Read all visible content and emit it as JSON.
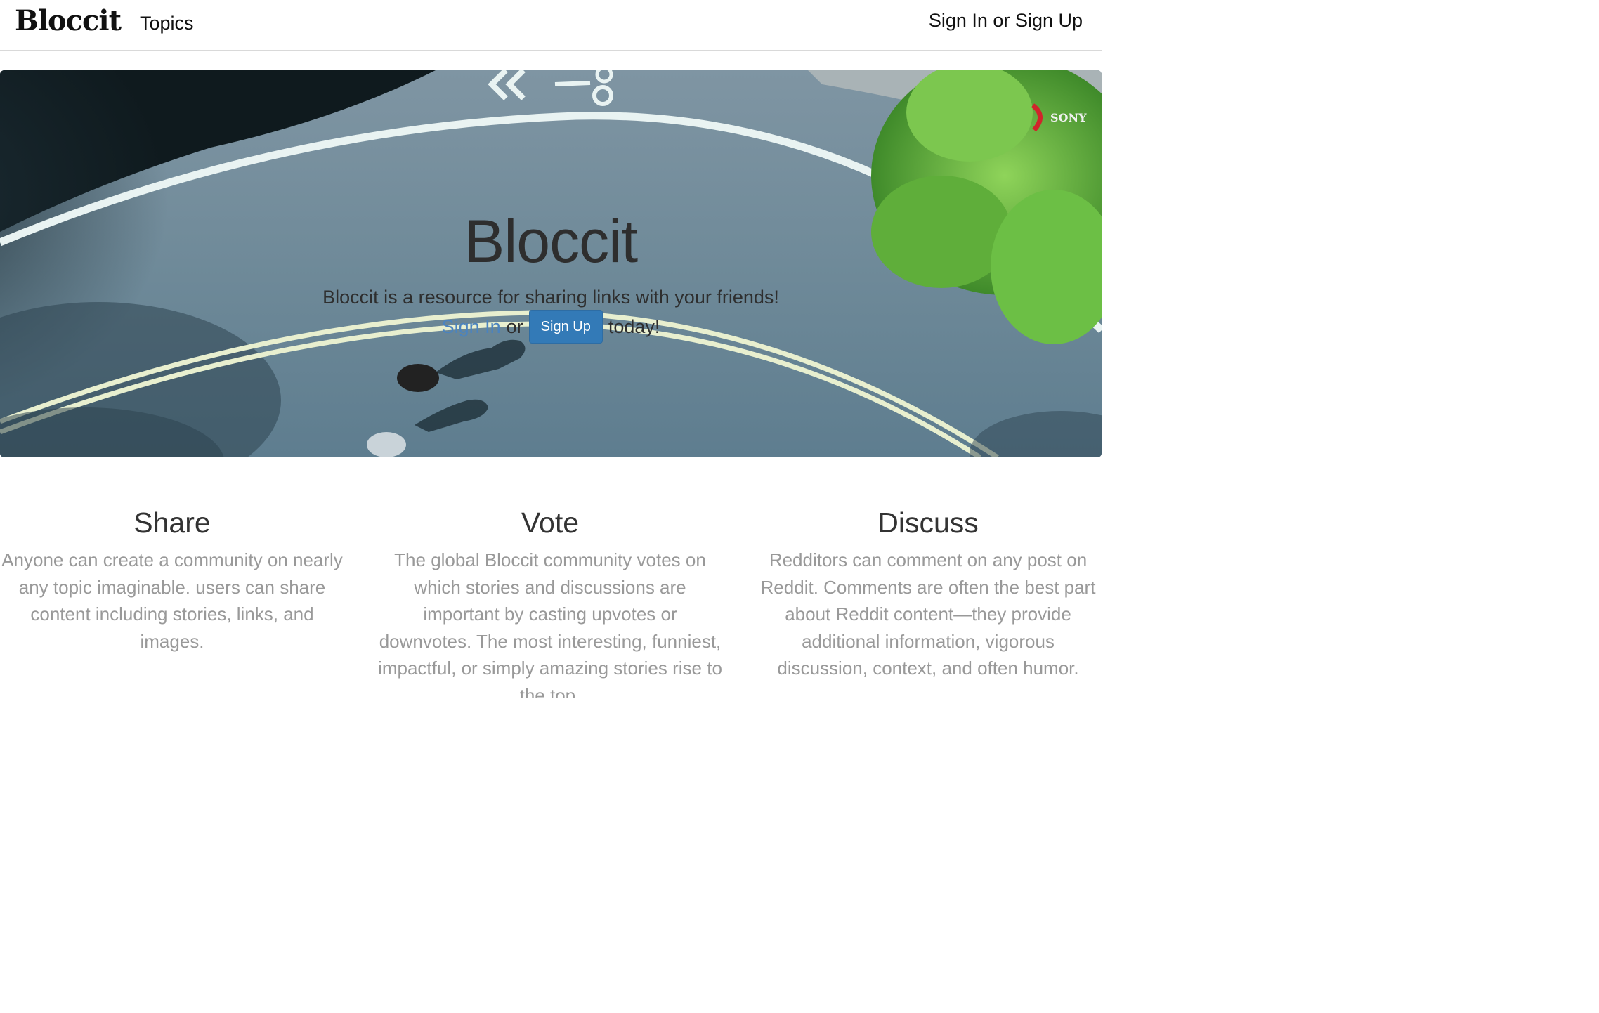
{
  "navbar": {
    "brand": "Bloccit",
    "topics_label": "Topics",
    "auth_label": "Sign In or Sign Up"
  },
  "hero": {
    "title": "Bloccit",
    "tagline": "Bloccit is a resource for sharing links with your friends!",
    "signin_label": "Sign In",
    "or_text": "or",
    "signup_label": "Sign Up",
    "today_text": "today!",
    "watermark": "SONY"
  },
  "features": [
    {
      "title": "Share",
      "text": "Anyone can create a community on nearly any topic imaginable. users can share content including stories, links, and images."
    },
    {
      "title": "Vote",
      "text": "The global Bloccit community votes on which stories and discussions are important by casting upvotes or downvotes. The most interesting, funniest, impactful, or simply amazing stories rise to the top."
    },
    {
      "title": "Discuss",
      "text": "Redditors can comment on any post on Reddit. Comments are often the best part about Reddit content—they provide additional information, vigorous discussion, context, and often humor."
    }
  ],
  "colors": {
    "primary_button": "#337ab7",
    "link": "#4a83bf",
    "muted_text": "#999999",
    "road": "#6c8797"
  }
}
